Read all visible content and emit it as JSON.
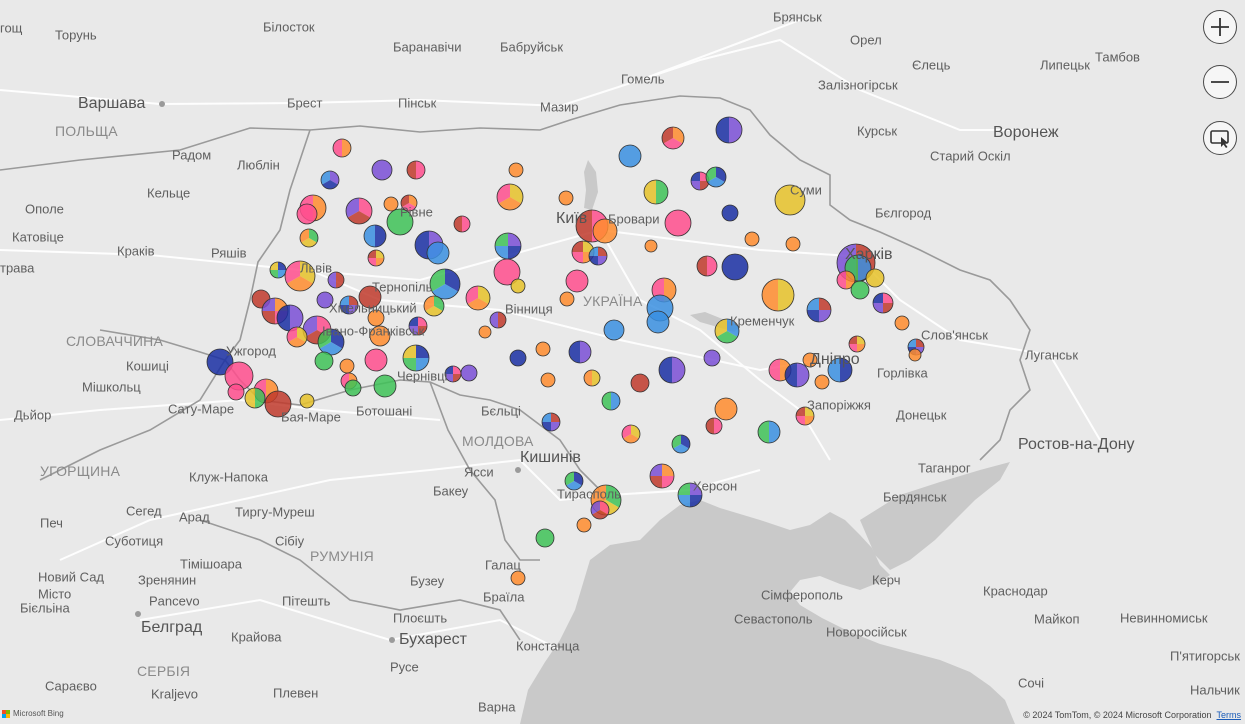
{
  "labels": [
    {
      "text": "Брянськ",
      "cls": ""
    },
    {
      "text": "Орел",
      "cls": ""
    },
    {
      "text": "Тамбов",
      "cls": ""
    },
    {
      "text": "Єлець",
      "cls": ""
    },
    {
      "text": "Липецьк",
      "cls": ""
    },
    {
      "text": "Залізногірськ",
      "cls": ""
    },
    {
      "text": "Курськ",
      "cls": ""
    },
    {
      "text": "Старий Оскіл",
      "cls": ""
    },
    {
      "text": "Воронеж",
      "cls": "big"
    },
    {
      "text": "Бєлгород",
      "cls": ""
    },
    {
      "text": "Суми",
      "cls": ""
    },
    {
      "text": "Харків",
      "cls": "big"
    },
    {
      "text": "Слов'янськ",
      "cls": ""
    },
    {
      "text": "Луганськ",
      "cls": ""
    },
    {
      "text": "Горлівка",
      "cls": ""
    },
    {
      "text": "Донецьк",
      "cls": ""
    },
    {
      "text": "Ростов-на-Дону",
      "cls": "big"
    },
    {
      "text": "Таганрог",
      "cls": ""
    },
    {
      "text": "Бердянськ",
      "cls": ""
    },
    {
      "text": "Запоріжжя",
      "cls": ""
    },
    {
      "text": "Дніпро",
      "cls": "big"
    },
    {
      "text": "Кременчук",
      "cls": ""
    },
    {
      "text": "УКРАЇНА",
      "cls": "country"
    },
    {
      "text": "Київ",
      "cls": "big"
    },
    {
      "text": "Бровари",
      "cls": ""
    },
    {
      "text": "Гомель",
      "cls": ""
    },
    {
      "text": "Мазир",
      "cls": ""
    },
    {
      "text": "Бабруйськ",
      "cls": ""
    },
    {
      "text": "Баранавічи",
      "cls": ""
    },
    {
      "text": "Пінськ",
      "cls": ""
    },
    {
      "text": "Брест",
      "cls": ""
    },
    {
      "text": "Білосток",
      "cls": ""
    },
    {
      "text": "Торунь",
      "cls": ""
    },
    {
      "text": "Варшава",
      "cls": "big"
    },
    {
      "text": "ПОЛЬЩА",
      "cls": "country"
    },
    {
      "text": "Радом",
      "cls": ""
    },
    {
      "text": "Люблін",
      "cls": ""
    },
    {
      "text": "Кельце",
      "cls": ""
    },
    {
      "text": "Ополе",
      "cls": ""
    },
    {
      "text": "Катовіце",
      "cls": ""
    },
    {
      "text": "Краків",
      "cls": ""
    },
    {
      "text": "Ряшів",
      "cls": ""
    },
    {
      "text": "Рівне",
      "cls": ""
    },
    {
      "text": "Львів",
      "cls": ""
    },
    {
      "text": "Тернопіль",
      "cls": ""
    },
    {
      "text": "Хмельницький",
      "cls": ""
    },
    {
      "text": "Івано-Франківськ",
      "cls": ""
    },
    {
      "text": "Вінниця",
      "cls": ""
    },
    {
      "text": "Ужгород",
      "cls": ""
    },
    {
      "text": "Чернівці",
      "cls": ""
    },
    {
      "text": "СЛОВАЧЧИНА",
      "cls": "country"
    },
    {
      "text": "Кошиці",
      "cls": ""
    },
    {
      "text": "Мішкольц",
      "cls": ""
    },
    {
      "text": "Дьйор",
      "cls": ""
    },
    {
      "text": "Сату-Маре",
      "cls": ""
    },
    {
      "text": "Бая-Маре",
      "cls": ""
    },
    {
      "text": "Ботошані",
      "cls": ""
    },
    {
      "text": "Бєльці",
      "cls": ""
    },
    {
      "text": "МОЛДОВА",
      "cls": "country"
    },
    {
      "text": "Кишинів",
      "cls": "big"
    },
    {
      "text": "Ясси",
      "cls": ""
    },
    {
      "text": "Бакеу",
      "cls": ""
    },
    {
      "text": "Тирасполь",
      "cls": ""
    },
    {
      "text": "Херсон",
      "cls": ""
    },
    {
      "text": "УГОРЩИНА",
      "cls": "country"
    },
    {
      "text": "Клуж-Напока",
      "cls": ""
    },
    {
      "text": "Сегед",
      "cls": ""
    },
    {
      "text": "Арад",
      "cls": ""
    },
    {
      "text": "Тиргу-Муреш",
      "cls": ""
    },
    {
      "text": "Печ",
      "cls": ""
    },
    {
      "text": "Суботиця",
      "cls": ""
    },
    {
      "text": "Сібіу",
      "cls": ""
    },
    {
      "text": "РУМУНІЯ",
      "cls": "country"
    },
    {
      "text": "Тімішоара",
      "cls": ""
    },
    {
      "text": "Новий Сад",
      "cls": ""
    },
    {
      "text": "Зренянин",
      "cls": ""
    },
    {
      "text": "Місто",
      "cls": ""
    },
    {
      "text": "Бієльіна",
      "cls": ""
    },
    {
      "text": "Pancevo",
      "cls": ""
    },
    {
      "text": "Бузеу",
      "cls": ""
    },
    {
      "text": "Галац",
      "cls": ""
    },
    {
      "text": "Браїла",
      "cls": ""
    },
    {
      "text": "Пітешть",
      "cls": ""
    },
    {
      "text": "Плоєшть",
      "cls": ""
    },
    {
      "text": "Белград",
      "cls": "big"
    },
    {
      "text": "Крайова",
      "cls": ""
    },
    {
      "text": "Бухарест",
      "cls": "big"
    },
    {
      "text": "Констанца",
      "cls": ""
    },
    {
      "text": "СЕРБІЯ",
      "cls": "country"
    },
    {
      "text": "Русе",
      "cls": ""
    },
    {
      "text": "Сараєво",
      "cls": ""
    },
    {
      "text": "Kraljevo",
      "cls": ""
    },
    {
      "text": "Плевен",
      "cls": ""
    },
    {
      "text": "Варна",
      "cls": ""
    },
    {
      "text": "Керч",
      "cls": ""
    },
    {
      "text": "Сімферополь",
      "cls": ""
    },
    {
      "text": "Севастополь",
      "cls": ""
    },
    {
      "text": "Новоросійськ",
      "cls": ""
    },
    {
      "text": "Краснодар",
      "cls": ""
    },
    {
      "text": "Майкоп",
      "cls": ""
    },
    {
      "text": "Невинномиськ",
      "cls": ""
    },
    {
      "text": "П'ятигорськ",
      "cls": ""
    },
    {
      "text": "Сочі",
      "cls": ""
    },
    {
      "text": "Нальчик",
      "cls": ""
    },
    {
      "text": "гощ",
      "cls": ""
    },
    {
      "text": "трава",
      "cls": ""
    }
  ],
  "controls": {
    "zoom_in_label": "+",
    "zoom_out_label": "−",
    "select_label": "Select"
  },
  "attribution": {
    "logo_text": "Microsoft Bing",
    "copyright": "© 2024 TomTom, © 2024 Microsoft Corporation",
    "terms": "Terms"
  },
  "colors": {
    "water": "#c9c9c9",
    "land": "#e9e9e9",
    "border": "#9a9a9a",
    "road": "#ffffff",
    "pie_palette": [
      "#ff8c2e",
      "#7a4fd6",
      "#3ec257",
      "#ff4d8d",
      "#1a2fa3",
      "#e6c229",
      "#c0392b",
      "#3a8fe0"
    ]
  }
}
